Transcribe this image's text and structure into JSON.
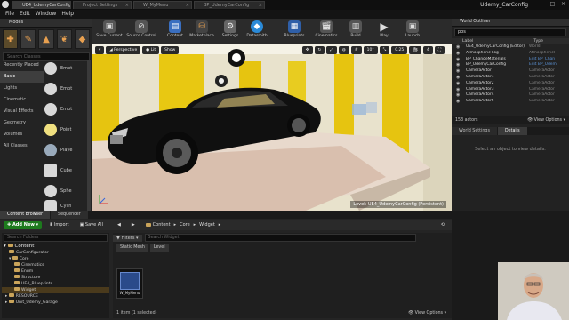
{
  "tabs": [
    "UE4_UdemyCarConfig",
    "Project Settings",
    "W_MyMenu",
    "BP_UdemyCarConfig"
  ],
  "app_title": "Udemy_CarConfig",
  "menu": [
    "File",
    "Edit",
    "Window",
    "Help"
  ],
  "modes": {
    "header": "Modes",
    "search_placeholder": "Search Classes",
    "categories": [
      "Recently Placed",
      "Basic",
      "Lights",
      "Cinematic",
      "Visual Effects",
      "Geometry",
      "Volumes",
      "All Classes"
    ],
    "selected_category": "Basic",
    "items": [
      "Empt",
      "Empt",
      "Empt",
      "Point",
      "Playe",
      "Cube",
      "Sphe",
      "Cylin"
    ]
  },
  "toolbar": {
    "buttons": [
      "Save Current",
      "Source Control",
      "Content",
      "Marketplace",
      "Settings",
      "Datasmith",
      "Blueprints",
      "Cinematics",
      "Build",
      "Play",
      "Launch"
    ]
  },
  "viewport": {
    "perspective": "Perspective",
    "lit": "Lit",
    "show": "Show",
    "angle": "10°",
    "scale": "0.25",
    "camera_speed": "4",
    "level_prefix": "Level:",
    "level_name": "UE4_UdemyCarConfig (Persistent)"
  },
  "outliner": {
    "tab": "World Outliner",
    "search_value": "pos",
    "col_label": "Label",
    "col_type": "Type",
    "rows": [
      {
        "name": "UE4_UdemyCarConfig (Editor)",
        "type": "World"
      },
      {
        "name": "Atmospheric Fog",
        "type": "AtmosphericF"
      },
      {
        "name": "BP_ChangeMaterials",
        "type": "Edit BP_Chan"
      },
      {
        "name": "BP_UdemyCarConfig",
        "type": "Edit BP_Udem"
      },
      {
        "name": "CameraActor",
        "type": "CameraActor"
      },
      {
        "name": "CameraActor1",
        "type": "CameraActor"
      },
      {
        "name": "CameraActor2",
        "type": "CameraActor"
      },
      {
        "name": "CameraActor3",
        "type": "CameraActor"
      },
      {
        "name": "CameraActor4",
        "type": "CameraActor"
      },
      {
        "name": "CameraActor5",
        "type": "CameraActor"
      }
    ],
    "count": "153 actors",
    "view_options": "View Options"
  },
  "details": {
    "tabs": [
      "World Settings",
      "Details"
    ],
    "message": "Select an object to view details."
  },
  "content_browser": {
    "tabs": [
      "Content Browser",
      "Sequencer"
    ],
    "add_new": "Add New",
    "import": "Import",
    "save_all": "Save All",
    "breadcrumb": [
      "Content",
      "Core",
      "Widget"
    ],
    "folder_search": "Search Folders",
    "filters": "Filters",
    "asset_search": "Search Widget",
    "filter_chips": [
      "Static Mesh",
      "Level"
    ],
    "tree": [
      "Content",
      "CarConfigurator",
      "Core",
      "Cinematics",
      "Enum",
      "Structure",
      "UE4_Blueprints",
      "Widget",
      "RESOURCE",
      "Unit_Udemy_Garage"
    ],
    "asset": "W_MyMenu",
    "status": "1 item (1 selected)",
    "view_options": "View Options"
  }
}
